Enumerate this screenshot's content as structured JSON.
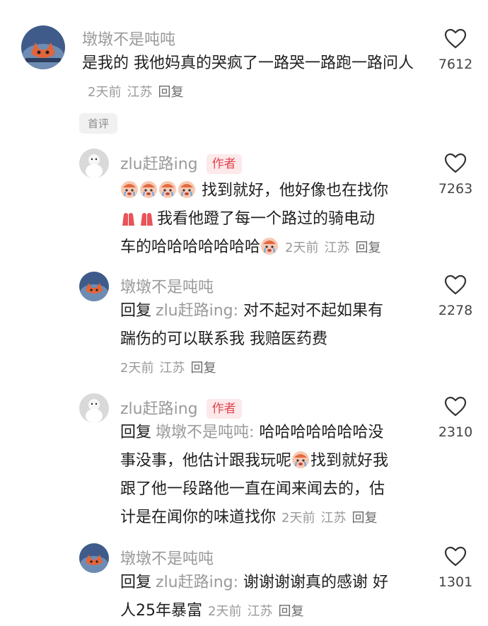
{
  "comments": [
    {
      "user": "墩墩不是吨吨",
      "text": "是我的  我他妈真的哭疯了一路哭一路跑一路问人",
      "time": "2天前",
      "location": "江苏",
      "reply_label": "回复",
      "likes": "7612",
      "pin_label": "首评"
    },
    {
      "user": "zlu赶路ing",
      "badge": "作者",
      "text_a": "找到就好，他好像也在找你",
      "text_b": "我看他蹬了每一个路过的骑电动",
      "text_c": "车的哈哈哈哈哈哈哈",
      "time": "2天前",
      "location": "江苏",
      "reply_label": "回复",
      "likes": "7263"
    },
    {
      "user": "墩墩不是吨吨",
      "reply_prefix": "回复",
      "reply_to": "zlu赶路ing:",
      "text_a": " 对不起对不起如果有",
      "text_b": "踹伤的可以联系我  我赔医药费",
      "time": "2天前",
      "location": "江苏",
      "reply_label": "回复",
      "likes": "2278"
    },
    {
      "user": "zlu赶路ing",
      "badge": "作者",
      "reply_prefix": "回复",
      "reply_to": "墩墩不是吨吨:",
      "text_a": " 哈哈哈哈哈哈哈没",
      "text_b": "事没事，他估计跟我玩呢",
      "text_b2": "找到就好我",
      "text_c": "跟了他一段路他一直在闻来闻去的，估",
      "text_d": "计是在闻你的味道找你",
      "time": "2天前",
      "location": "江苏",
      "reply_label": "回复",
      "likes": "2310"
    },
    {
      "user": "墩墩不是吨吨",
      "reply_prefix": "回复",
      "reply_to": "zlu赶路ing:",
      "text_a": " 谢谢谢谢真的感谢  好",
      "text_b": "人25年暴富",
      "time": "2天前",
      "location": "江苏",
      "reply_label": "回复",
      "likes": "1301"
    }
  ],
  "icons": {
    "like": "heart-outline-icon",
    "emoji_cry": "crying-face-emoji-icon",
    "emoji_pray": "praying-hands-emoji-icon"
  },
  "colors": {
    "author_badge": "#e0454e",
    "meta": "#9a9a9a"
  }
}
